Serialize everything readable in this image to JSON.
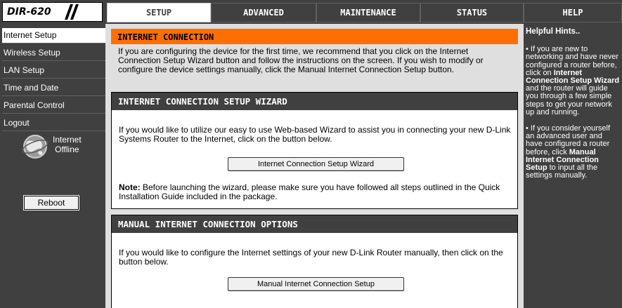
{
  "logo": {
    "text": "DIR-620"
  },
  "tabs": [
    {
      "label": "SETUP",
      "active": true
    },
    {
      "label": "ADVANCED",
      "active": false
    },
    {
      "label": "MAINTENANCE",
      "active": false
    },
    {
      "label": "STATUS",
      "active": false
    },
    {
      "label": "HELP",
      "active": false
    }
  ],
  "sidebar": {
    "items": [
      {
        "label": "Internet Setup",
        "active": true
      },
      {
        "label": "Wireless Setup",
        "active": false
      },
      {
        "label": "LAN Setup",
        "active": false
      },
      {
        "label": "Time and Date",
        "active": false
      },
      {
        "label": "Parental Control",
        "active": false
      },
      {
        "label": "Logout",
        "active": false
      }
    ],
    "status_line1": "Internet",
    "status_line2": "Offline",
    "reboot_label": "Reboot"
  },
  "internet_connection": {
    "title": "INTERNET CONNECTION",
    "text": "If you are configuring the device for the first time, we recommend that you click on the Internet Connection Setup Wizard button and follow the instructions on the screen. If you wish to modify or configure the device settings manually, click the Manual Internet Connection Setup button."
  },
  "wizard": {
    "title": "INTERNET CONNECTION SETUP WIZARD",
    "text": "If you would like to utilize our easy to use Web-based Wizard to assist you in connecting your new D-Link Systems Router to the Internet, click on the button below.",
    "button_label": "Internet Connection Setup Wizard",
    "note_label": "Note:",
    "note_text": " Before launching the wizard, please make sure you have followed all steps outlined in the Quick Installation Guide included in the package."
  },
  "manual": {
    "title": "MANUAL INTERNET CONNECTION OPTIONS",
    "text": "If you would like to configure the Internet settings of your new D-Link Router manually, then click on the button below.",
    "button_label": "Manual Internet Connection Setup"
  },
  "help": {
    "title": "Helpful Hints..",
    "hint1_pre": "• If you are new to networking and have never configured a router before, click on ",
    "hint1_bold": "Internet Connection Setup Wizard",
    "hint1_post": " and the router will guide you through a few simple steps to get your network up and running.",
    "hint2_pre": "• If you consider yourself an advanced user and have configured a router before, click ",
    "hint2_bold": "Manual Internet Connection Setup",
    "hint2_post": " to input all the settings manually."
  },
  "colors": {
    "accent_orange": "#ff6f00",
    "dark_gray": "#404040",
    "content_bg": "#dfdfdf"
  }
}
